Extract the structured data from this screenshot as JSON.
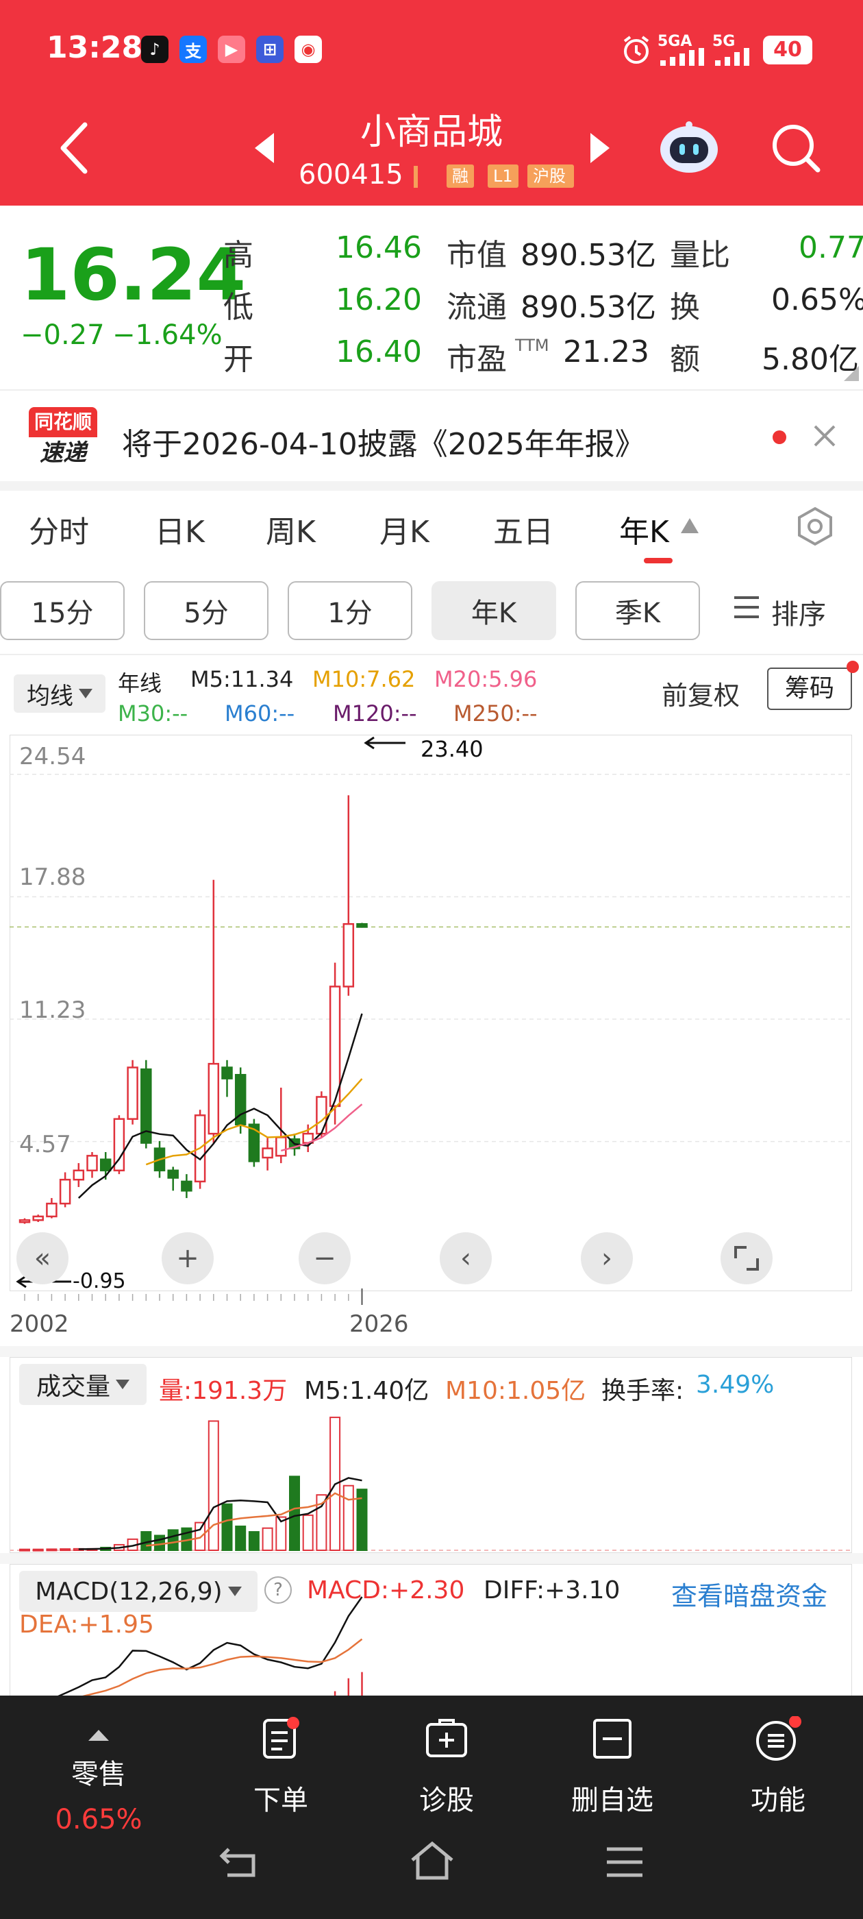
{
  "status": {
    "time": "13:28",
    "network1": "5GA",
    "network2": "5G",
    "battery": "40"
  },
  "header": {
    "title": "小商品城",
    "code": "600415",
    "tags": [
      "融",
      "L1",
      "沪股"
    ]
  },
  "quote": {
    "price": "16.24",
    "change": "−0.27",
    "change_pct": "−1.64%",
    "high_label": "高",
    "high": "16.46",
    "low_label": "低",
    "low": "16.20",
    "open_label": "开",
    "open": "16.40",
    "mcap_label": "市值",
    "mcap": "890.53亿",
    "float_label": "流通",
    "float": "890.53亿",
    "pe_label": "市盈",
    "pe_sup": "TTM",
    "pe": "21.23",
    "volratio_label": "量比",
    "volratio": "0.77",
    "turnover_label": "换",
    "turnover": "0.65%",
    "amount_label": "额",
    "amount": "5.80亿"
  },
  "notice": {
    "logo_top": "同花顺",
    "logo_bottom": "速递",
    "text": "将于2026-04-10披露《2025年年报》"
  },
  "tabs": [
    "分时",
    "日K",
    "周K",
    "月K",
    "五日",
    "年K"
  ],
  "periods": [
    "15分",
    "5分",
    "1分",
    "年K",
    "季K",
    "排序"
  ],
  "indicator": {
    "selector": "均线",
    "name": "年线",
    "m5": "M5:11.34",
    "m10": "M10:7.62",
    "m20": "M20:5.96",
    "m30": "M30:--",
    "m60": "M60:--",
    "m120": "M120:--",
    "m250": "M250:--",
    "fq": "前复权",
    "chips": "筹码"
  },
  "chart_data": {
    "type": "candlestick",
    "y_ticks": [
      "24.54",
      "17.88",
      "11.23",
      "4.57"
    ],
    "high_marker": "23.40",
    "low_marker": "-0.95",
    "x_labels": [
      "2002",
      "2026"
    ],
    "ylim": [
      -2.0,
      25.5
    ],
    "current_price": 16.24,
    "candles": [
      {
        "o": 0.2,
        "c": 0.3,
        "h": 0.4,
        "l": 0.1
      },
      {
        "o": 0.3,
        "c": 0.5,
        "h": 0.6,
        "l": 0.2
      },
      {
        "o": 0.5,
        "c": 1.2,
        "h": 1.5,
        "l": 0.4
      },
      {
        "o": 1.2,
        "c": 2.5,
        "h": 2.9,
        "l": 1.0
      },
      {
        "o": 2.5,
        "c": 3.0,
        "h": 3.4,
        "l": 2.1
      },
      {
        "o": 3.0,
        "c": 3.8,
        "h": 4.0,
        "l": 2.6
      },
      {
        "o": 3.6,
        "c": 3.0,
        "h": 4.0,
        "l": 2.5
      },
      {
        "o": 3.0,
        "c": 5.8,
        "h": 6.0,
        "l": 2.8
      },
      {
        "o": 5.8,
        "c": 8.6,
        "h": 9.0,
        "l": 5.5
      },
      {
        "o": 8.5,
        "c": 4.5,
        "h": 9.0,
        "l": 4.2
      },
      {
        "o": 4.2,
        "c": 3.0,
        "h": 4.6,
        "l": 2.6
      },
      {
        "o": 3.0,
        "c": 2.6,
        "h": 3.2,
        "l": 1.9
      },
      {
        "o": 2.4,
        "c": 1.9,
        "h": 2.8,
        "l": 1.5
      },
      {
        "o": 2.4,
        "c": 6.0,
        "h": 6.3,
        "l": 2.0
      },
      {
        "o": 5.0,
        "c": 8.8,
        "h": 18.8,
        "l": 4.5
      },
      {
        "o": 8.6,
        "c": 8.0,
        "h": 9.0,
        "l": 7.0
      },
      {
        "o": 8.2,
        "c": 5.5,
        "h": 8.6,
        "l": 5.0
      },
      {
        "o": 5.5,
        "c": 3.5,
        "h": 5.8,
        "l": 3.2
      },
      {
        "o": 3.7,
        "c": 4.2,
        "h": 4.8,
        "l": 3.0
      },
      {
        "o": 3.8,
        "c": 4.8,
        "h": 7.5,
        "l": 3.4
      },
      {
        "o": 4.7,
        "c": 4.2,
        "h": 5.0,
        "l": 3.8
      },
      {
        "o": 4.5,
        "c": 5.0,
        "h": 5.5,
        "l": 4.0
      },
      {
        "o": 5.0,
        "c": 7.0,
        "h": 7.3,
        "l": 4.8
      },
      {
        "o": 6.5,
        "c": 13.0,
        "h": 14.3,
        "l": 5.5
      },
      {
        "o": 13.0,
        "c": 16.4,
        "h": 23.4,
        "l": 12.5
      },
      {
        "o": 16.4,
        "c": 16.24,
        "h": 16.46,
        "l": 16.2
      }
    ]
  },
  "chart_controls": {
    "prev": "‹",
    "next": "›"
  },
  "volume": {
    "selector": "成交量",
    "vol": "量:191.3万",
    "m5": "M5:1.40亿",
    "m10": "M10:1.05亿",
    "turnover_label": "换手率:",
    "turnover": "3.49%",
    "bars": [
      0.05,
      0.05,
      0.06,
      0.07,
      0.08,
      0.08,
      0.15,
      0.3,
      0.6,
      1.0,
      0.8,
      1.1,
      1.2,
      1.5,
      7.0,
      2.5,
      1.3,
      1.0,
      1.2,
      1.8,
      4.0,
      1.9,
      3.0,
      7.2,
      3.5,
      3.3
    ],
    "bars_up": [
      true,
      true,
      true,
      true,
      true,
      true,
      false,
      true,
      true,
      false,
      false,
      false,
      false,
      true,
      true,
      false,
      false,
      false,
      true,
      true,
      false,
      true,
      true,
      true,
      true,
      false
    ],
    "ylim": [
      0,
      7.5
    ]
  },
  "macd": {
    "selector": "MACD(12,26,9)",
    "macd": "MACD:+2.30",
    "diff": "DIFF:+3.10",
    "dea": "DEA:+1.95",
    "link": "查看暗盘资金"
  },
  "bottom_nav": {
    "lingshou": "零售",
    "lingshou_pct": "0.65%",
    "order": "下单",
    "diagnose": "诊股",
    "remove": "删自选",
    "functions": "功能"
  }
}
